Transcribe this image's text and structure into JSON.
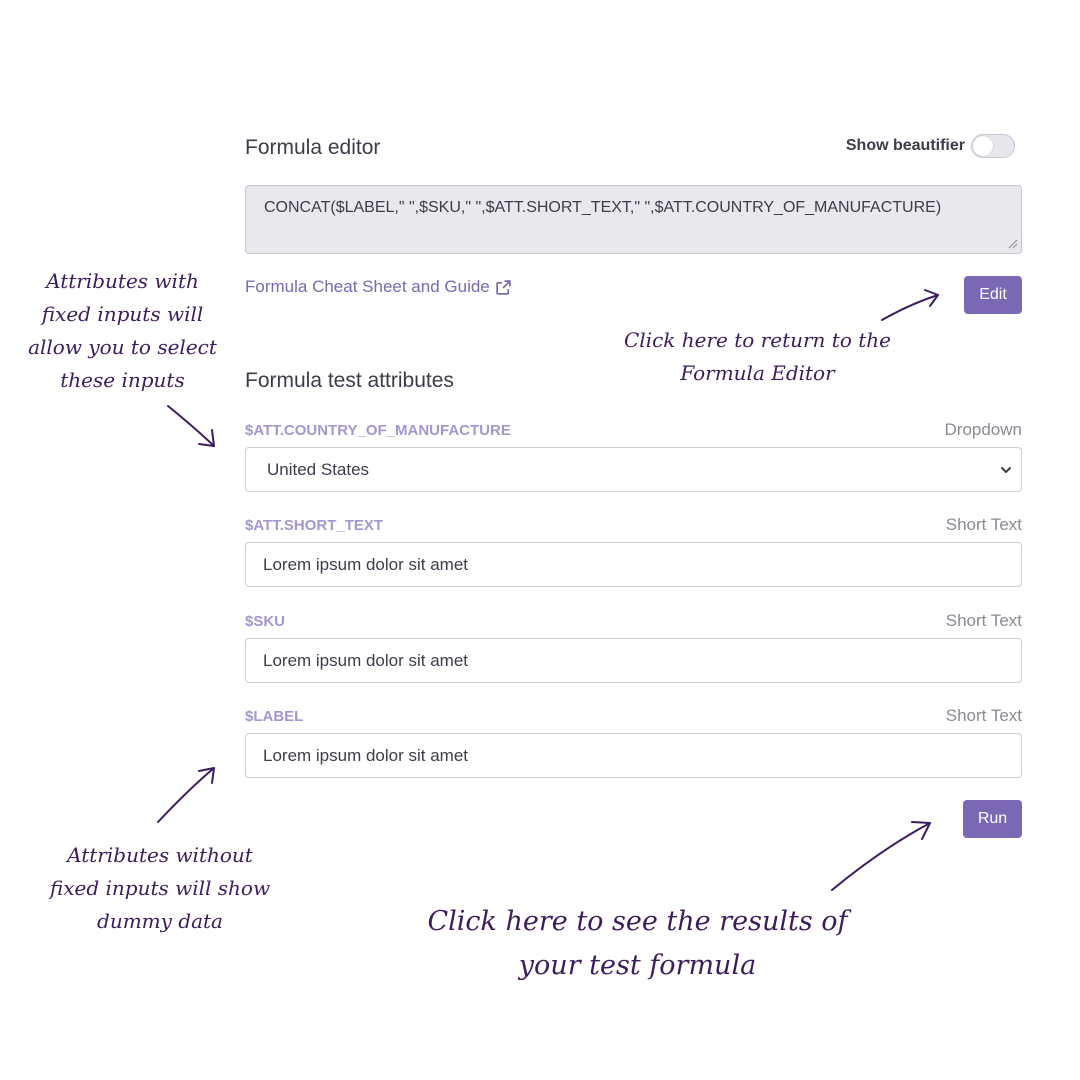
{
  "editor": {
    "title": "Formula editor",
    "beautifier_label": "Show beautifier",
    "beautifier_on": false,
    "formula": "CONCAT($LABEL,\" \",$SKU,\" \",$ATT.SHORT_TEXT,\" \",$ATT.COUNTRY_OF_MANUFACTURE)",
    "cheat_sheet_link": "Formula Cheat Sheet and Guide",
    "edit_label": "Edit"
  },
  "test": {
    "title": "Formula test attributes",
    "attributes": [
      {
        "name": "$ATT.COUNTRY_OF_MANUFACTURE",
        "type": "Dropdown",
        "value": "United States"
      },
      {
        "name": "$ATT.SHORT_TEXT",
        "type": "Short Text",
        "value": "Lorem ipsum dolor sit amet"
      },
      {
        "name": "$SKU",
        "type": "Short Text",
        "value": "Lorem ipsum dolor sit amet"
      },
      {
        "name": "$LABEL",
        "type": "Short Text",
        "value": "Lorem ipsum dolor sit amet"
      }
    ],
    "run_label": "Run"
  },
  "annotations": {
    "fixed_inputs": [
      "Attributes with",
      "fixed inputs will",
      "allow you to select",
      "these inputs"
    ],
    "return_editor": [
      "Click here to return to the",
      "Formula Editor"
    ],
    "dummy_data": [
      "Attributes without",
      "fixed inputs will show",
      "dummy data"
    ],
    "run_results": [
      "Click here to see the results of",
      "your test formula"
    ]
  },
  "colors": {
    "accent": "#7b68b5",
    "attr_name": "#a496cf",
    "annotation": "#3c1d5e"
  },
  "icons": [
    "external-link-icon",
    "chevron-down-icon",
    "resize-grip-icon"
  ]
}
